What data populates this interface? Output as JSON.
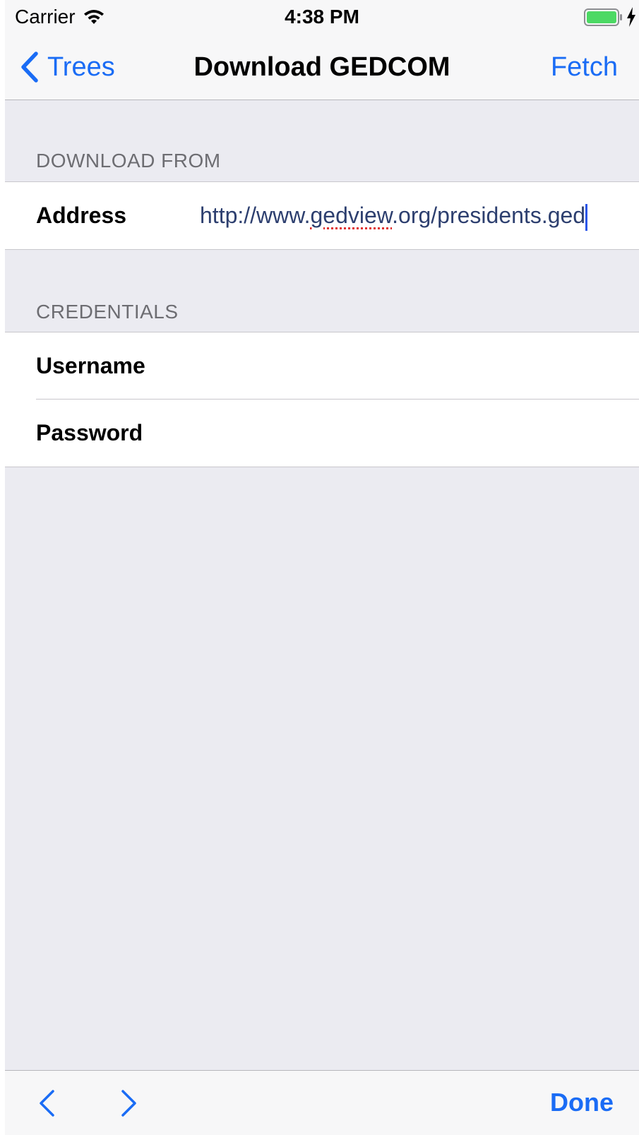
{
  "status_bar": {
    "carrier": "Carrier",
    "time": "4:38 PM",
    "wifi_icon": "wifi-icon",
    "battery_icon": "battery-full-icon",
    "charging_icon": "charging-bolt-icon",
    "battery_color": "#4cd964"
  },
  "nav_bar": {
    "back_label": "Trees",
    "back_icon": "chevron-left-icon",
    "title": "Download GEDCOM",
    "fetch_label": "Fetch",
    "tint_color": "#1a6cf5"
  },
  "download_section": {
    "header": "DOWNLOAD FROM",
    "address_label": "Address",
    "address_prefix": "http://www.",
    "address_misspelled": "gedview",
    "address_suffix": ".org/presidents.ged"
  },
  "credentials_section": {
    "header": "CREDENTIALS",
    "username_label": "Username",
    "username_value": "",
    "password_label": "Password",
    "password_value": ""
  },
  "toolbar": {
    "prev_icon": "chevron-left-icon",
    "next_icon": "chevron-right-icon",
    "done_label": "Done"
  }
}
